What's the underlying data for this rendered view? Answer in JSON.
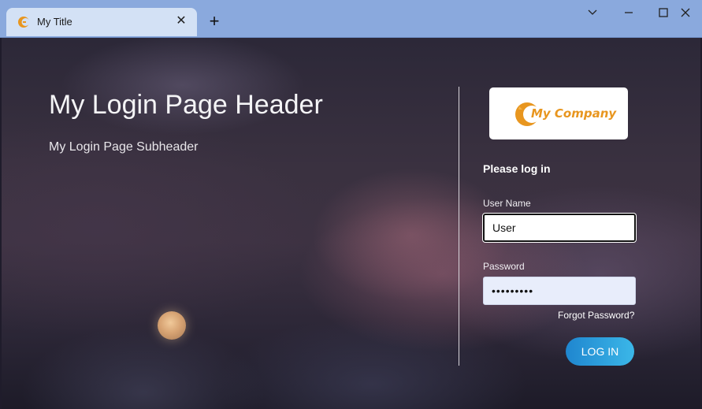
{
  "browser": {
    "tab_title": "My Title",
    "tab_close_icon": "close-icon",
    "new_tab_symbol": "+",
    "window_controls": [
      "chevron-down-icon",
      "minimize-icon",
      "maximize-icon",
      "close-icon"
    ],
    "chrome_color": "#8aa9dd",
    "tab_color": "#d3e1f5"
  },
  "page": {
    "header": "My Login Page Header",
    "subheader": "My Login Page Subheader",
    "background": "night sky with clouds and moon"
  },
  "login": {
    "logo_text": "My Company",
    "logo_color": "#e8961f",
    "prompt": "Please log in",
    "username_label": "User Name",
    "username_value": "User",
    "password_label": "Password",
    "password_value": "•••••••••",
    "forgot_password": "Forgot Password?",
    "login_button": "LOG IN",
    "button_color": "#2a9fdc"
  }
}
